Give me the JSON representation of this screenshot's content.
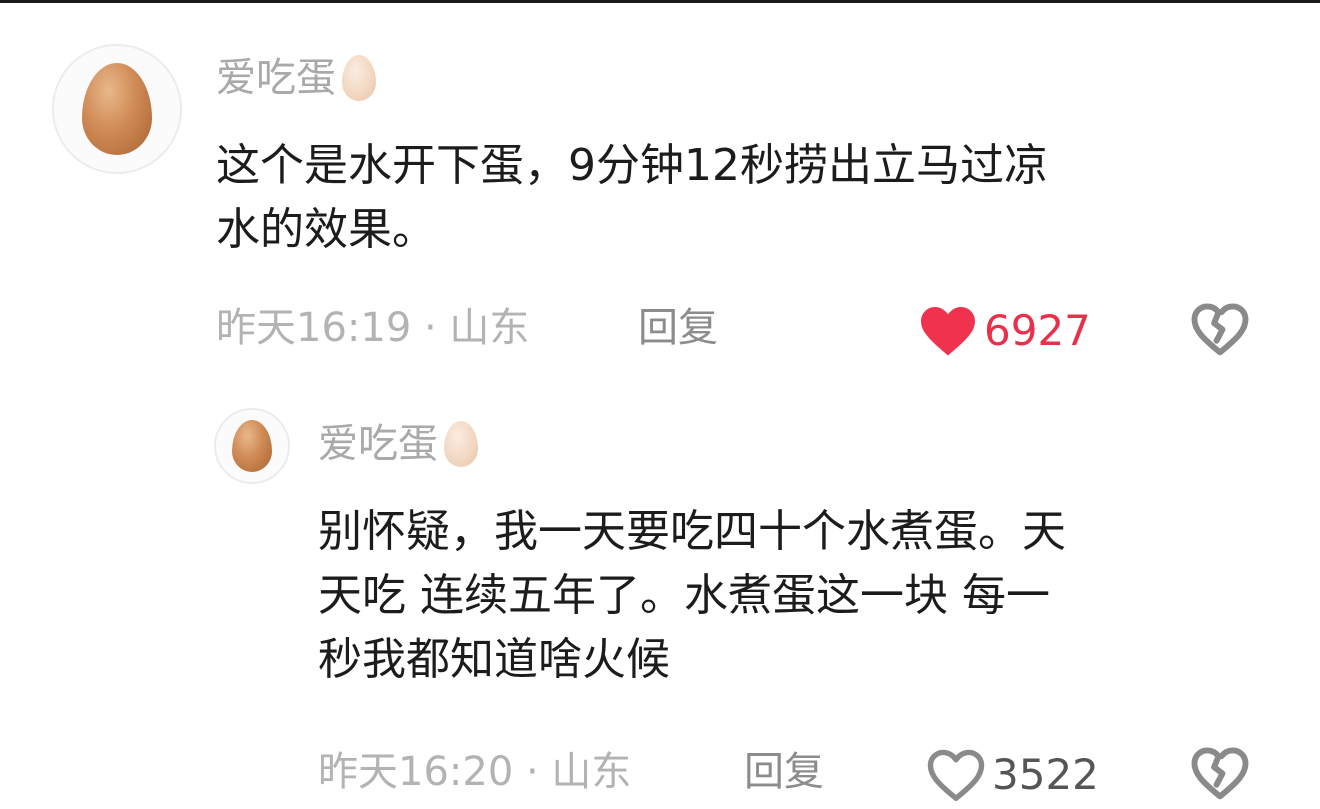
{
  "colors": {
    "liked_heart": "#f0324f",
    "liked_count": "#e9304a",
    "muted_text": "#b3b3b3",
    "icon_gray": "#8a8a8a"
  },
  "comments": [
    {
      "username": "爱吃蛋",
      "avatar_icon": "egg-avatar",
      "username_badge_icon": "egg-icon",
      "text_lines": [
        "这个是水开下蛋，9分钟12秒捞出立马过凉",
        "水的效果。"
      ],
      "timestamp": "昨天16:19 · 山东",
      "reply_label": "回复",
      "likes": "6927",
      "liked": true,
      "like_icon": "heart-filled-icon",
      "dislike_icon": "broken-heart-icon"
    },
    {
      "username": "爱吃蛋",
      "avatar_icon": "egg-avatar",
      "username_badge_icon": "egg-icon",
      "text_lines": [
        "别怀疑，我一天要吃四十个水煮蛋。天",
        "天吃 连续五年了。水煮蛋这一块 每一",
        "秒我都知道啥火候"
      ],
      "timestamp": "昨天16:20 · 山东",
      "reply_label": "回复",
      "likes": "3522",
      "liked": false,
      "like_icon": "heart-outline-icon",
      "dislike_icon": "broken-heart-icon"
    }
  ]
}
